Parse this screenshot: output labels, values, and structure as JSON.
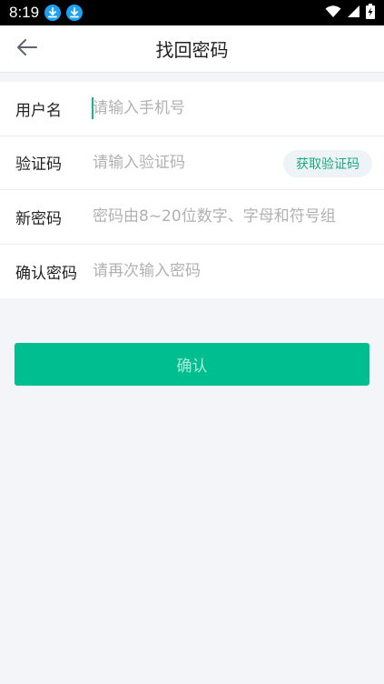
{
  "status_bar": {
    "time": "8:19",
    "icons": [
      "download-icon",
      "download-icon",
      "wifi-icon",
      "signal-icon",
      "battery-charging-icon"
    ]
  },
  "header": {
    "title": "找回密码",
    "back_icon": "arrow-left-icon"
  },
  "form": {
    "fields": [
      {
        "label": "用户名",
        "placeholder": "请输入手机号",
        "value": ""
      },
      {
        "label": "验证码",
        "placeholder": "请输入验证码",
        "value": ""
      },
      {
        "label": "新密码",
        "placeholder": "密码由8~20位数字、字母和符号组",
        "value": ""
      },
      {
        "label": "确认密码",
        "placeholder": "请再次输入密码",
        "value": ""
      }
    ],
    "get_code_label": "获取验证码"
  },
  "confirm_label": "确认",
  "colors": {
    "accent": "#00be8f",
    "page_bg": "#f4f5f9"
  }
}
